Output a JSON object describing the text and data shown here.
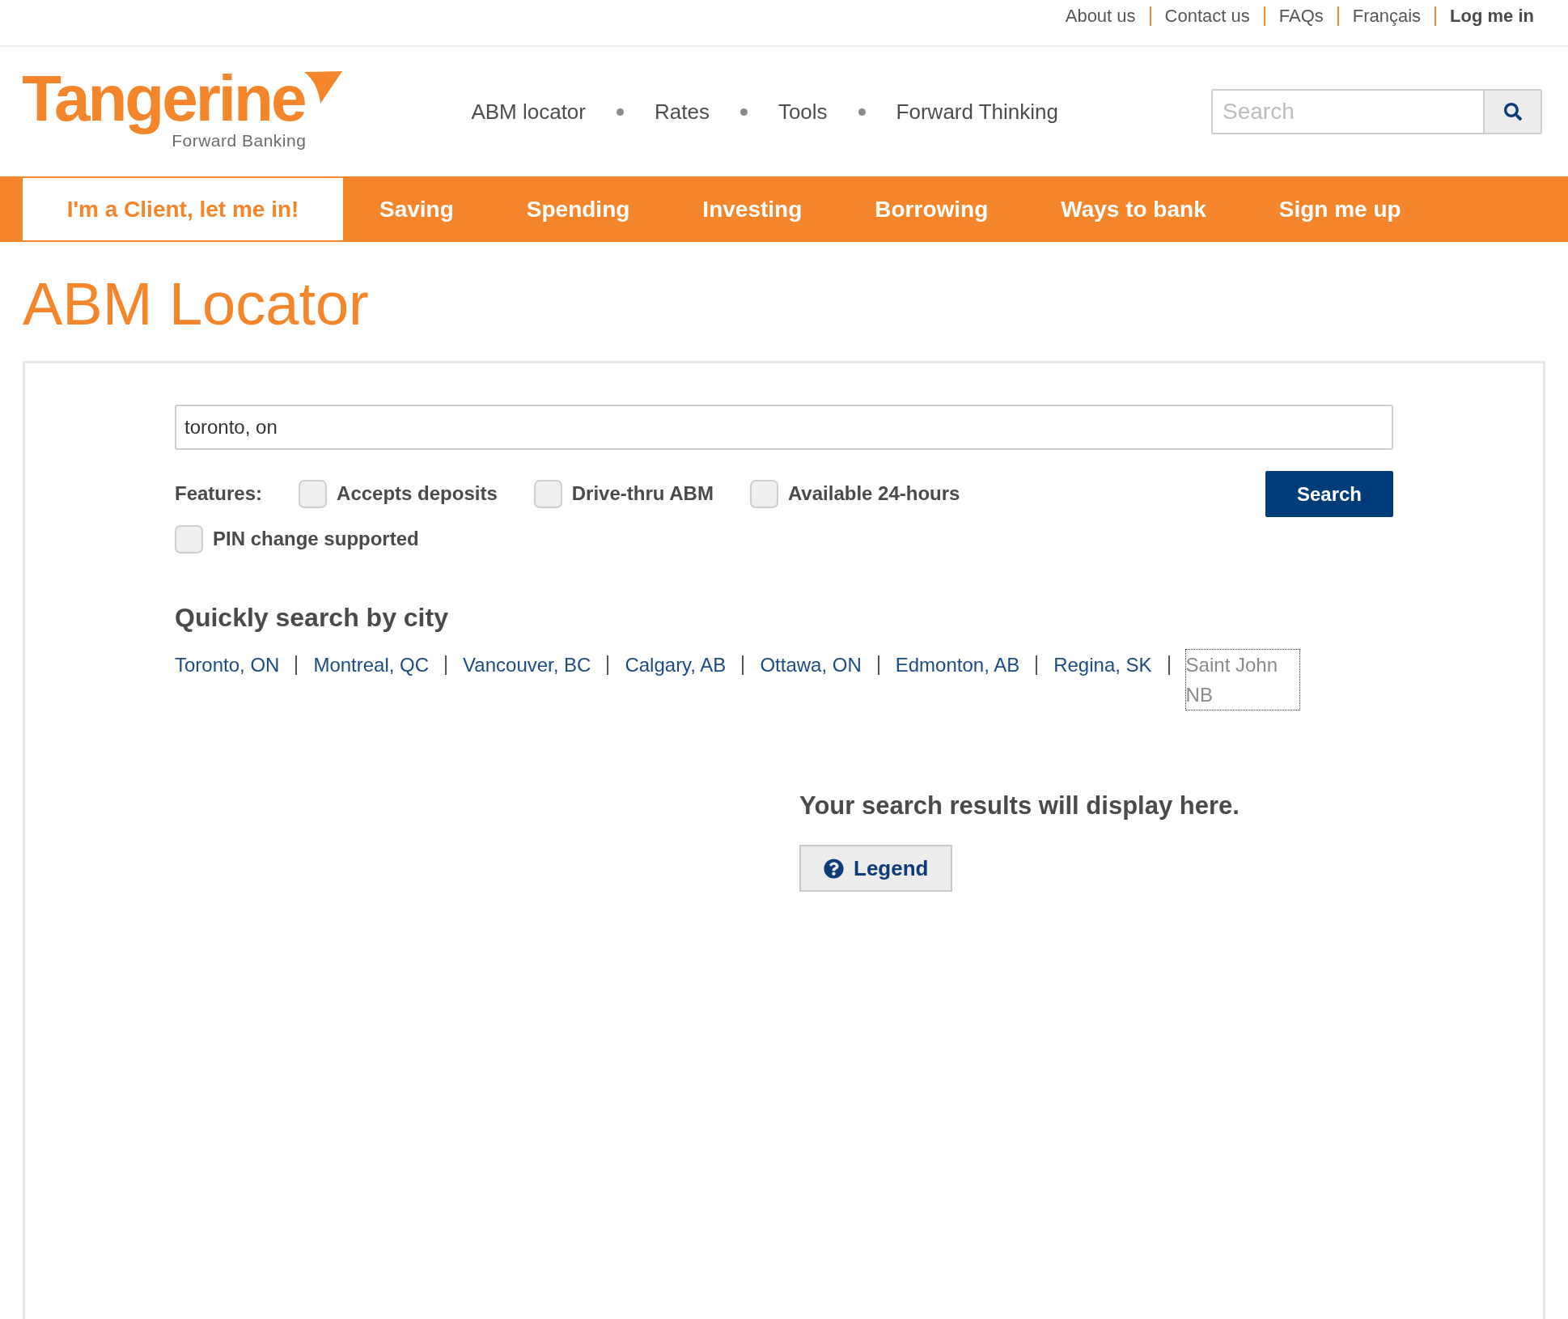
{
  "top_links": [
    {
      "label": "About us",
      "kind": "link"
    },
    {
      "label": "Contact us",
      "kind": "link"
    },
    {
      "label": "FAQs",
      "kind": "link"
    },
    {
      "label": "Français",
      "kind": "link"
    },
    {
      "label": "Log me in",
      "kind": "login"
    }
  ],
  "logo": {
    "wordmark": "Tangerine",
    "tagline": "Forward Banking"
  },
  "header_nav": [
    "ABM locator",
    "Rates",
    "Tools",
    "Forward Thinking"
  ],
  "site_search": {
    "placeholder": "Search"
  },
  "main_nav": [
    {
      "label": "I'm a Client, let me in!",
      "kind": "client"
    },
    {
      "label": "Saving",
      "kind": "menu"
    },
    {
      "label": "Spending",
      "kind": "menu"
    },
    {
      "label": "Investing",
      "kind": "menu"
    },
    {
      "label": "Borrowing",
      "kind": "menu"
    },
    {
      "label": "Ways to bank",
      "kind": "menu"
    },
    {
      "label": "Sign me up",
      "kind": "menu"
    }
  ],
  "page_title": "ABM Locator",
  "locator": {
    "location": {
      "value": "toronto, on"
    },
    "features_label": "Features:",
    "features": [
      {
        "label": "Accepts deposits",
        "checked": false
      },
      {
        "label": "Drive-thru ABM",
        "checked": false
      },
      {
        "label": "Available 24-hours",
        "checked": false
      },
      {
        "label": "PIN change supported",
        "checked": false
      }
    ],
    "search_button": "Search",
    "quick_search": {
      "heading": "Quickly search by city",
      "cities": [
        {
          "label": "Toronto, ON",
          "focused": false
        },
        {
          "label": "Montreal, QC",
          "focused": false
        },
        {
          "label": "Vancouver, BC",
          "focused": false
        },
        {
          "label": "Calgary, AB",
          "focused": false
        },
        {
          "label": "Ottawa, ON",
          "focused": false
        },
        {
          "label": "Edmonton, AB",
          "focused": false
        },
        {
          "label": "Regina, SK",
          "focused": false
        },
        {
          "label": "Saint John NB",
          "focused": true
        }
      ]
    },
    "results": {
      "message": "Your search results will display here.",
      "legend_button": "Legend"
    }
  }
}
